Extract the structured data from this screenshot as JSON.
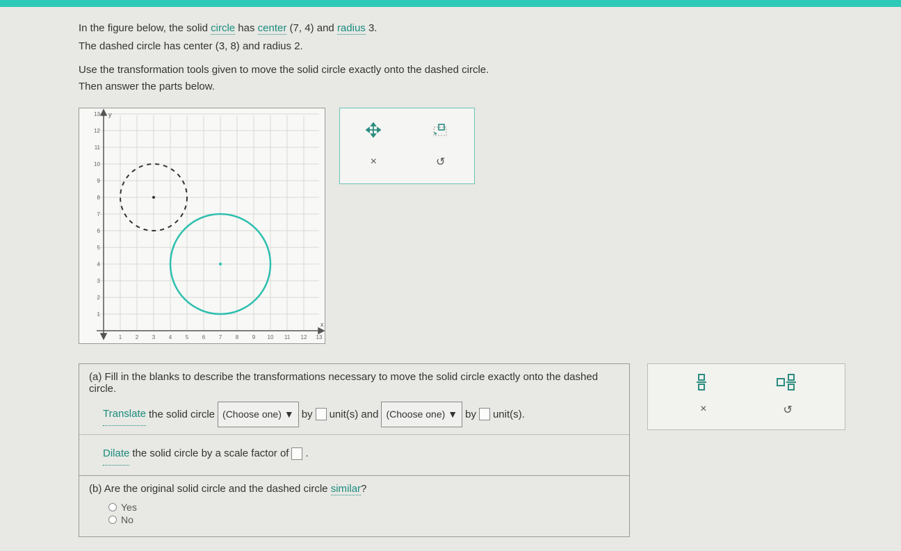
{
  "question": {
    "line1a": "In the figure below, the solid ",
    "term_circle": "circle",
    "line1b": " has ",
    "term_center": "center",
    "center1": " (7,  4) ",
    "line1c": "and ",
    "term_radius": "radius",
    "radius1": " 3.",
    "line2a": "The dashed circle has center ",
    "center2": "(3,  8)",
    "line2b": " and radius ",
    "radius2": "2."
  },
  "instruction": {
    "l1": "Use the transformation tools given to move the solid circle exactly onto the dashed circle.",
    "l2": "Then answer the parts below."
  },
  "tools": {
    "move": "✥",
    "dilate": "⬚",
    "clear": "×",
    "undo": "↺"
  },
  "parts": {
    "a": {
      "label": "(a)",
      "text": "Fill in the blanks to describe the transformations necessary to move the solid circle exactly onto the dashed circle.",
      "translate_term": "Translate",
      "translate_rest": " the solid circle ",
      "choose": "(Choose one)",
      "by": " by ",
      "units_and": " unit(s) and ",
      "units_end": " unit(s).",
      "dilate_term": "Dilate",
      "dilate_rest": " the solid circle by a scale factor of ",
      "period": "."
    },
    "b": {
      "label": "(b)",
      "text": "Are the original solid circle and the dashed circle ",
      "similar_term": "similar",
      "q": "?",
      "yes": "Yes",
      "no": "No"
    }
  },
  "side": {
    "clear": "×",
    "undo": "↺"
  },
  "chart_data": {
    "type": "scatter",
    "title": "",
    "xlabel": "x",
    "ylabel": "y",
    "xlim": [
      0,
      13
    ],
    "ylim": [
      0,
      13
    ],
    "grid": true,
    "circles": [
      {
        "name": "solid",
        "center": [
          7,
          4
        ],
        "radius": 3,
        "style": "solid",
        "color": "#2dbfae"
      },
      {
        "name": "dashed",
        "center": [
          3,
          8
        ],
        "radius": 2,
        "style": "dashed",
        "color": "#333333"
      }
    ]
  }
}
